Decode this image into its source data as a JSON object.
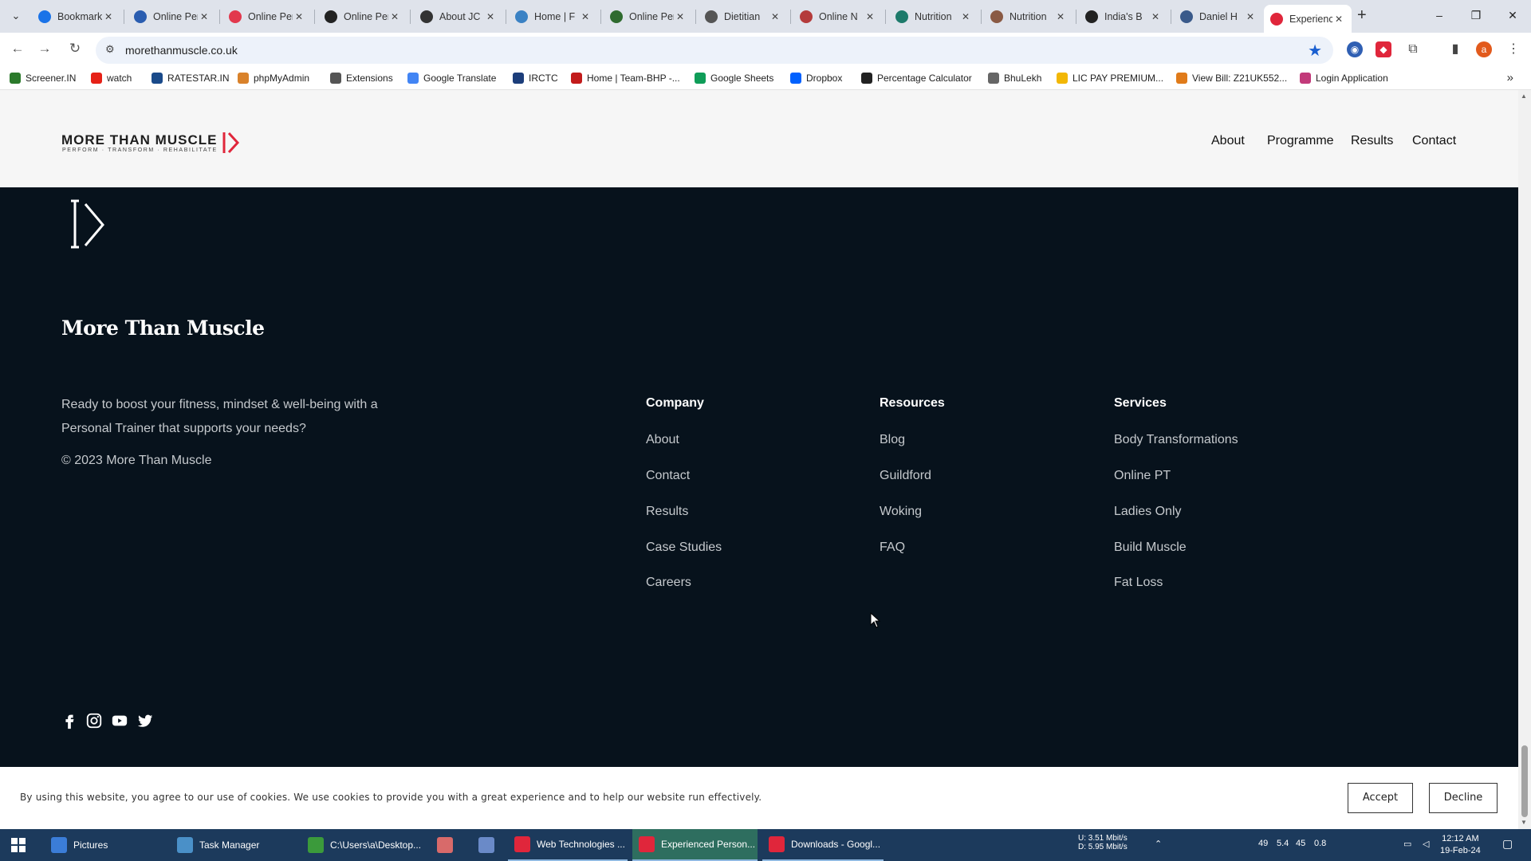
{
  "browser": {
    "tabs": [
      {
        "title": "Bookmarks",
        "color": "#1a73e8"
      },
      {
        "title": "Online Personal",
        "color": "#2a5db0"
      },
      {
        "title": "Online Personal",
        "color": "#e2384d"
      },
      {
        "title": "Online Personal",
        "color": "#222222"
      },
      {
        "title": "About JC",
        "color": "#333333"
      },
      {
        "title": "Home | F",
        "color": "#3b82c4"
      },
      {
        "title": "Online Personal",
        "color": "#2f6b2f"
      },
      {
        "title": "Dietitian",
        "color": "#555555"
      },
      {
        "title": "Online N",
        "color": "#b43b3b"
      },
      {
        "title": "Nutrition",
        "color": "#1d7a6b"
      },
      {
        "title": "Nutrition",
        "color": "#8a5a44"
      },
      {
        "title": "India's B",
        "color": "#222222"
      },
      {
        "title": "Daniel H",
        "color": "#3a5a8a"
      },
      {
        "title": "Experienced",
        "color": "#e0263b"
      }
    ],
    "new_tab": "+",
    "window_controls": {
      "minimize": "–",
      "restore": "❐",
      "close": "✕"
    },
    "url": "morethanmuscle.co.uk",
    "profile_initial": "a",
    "bookmarks": [
      {
        "label": "Screener.IN",
        "color": "#2b7a2b"
      },
      {
        "label": "watch",
        "color": "#e62117"
      },
      {
        "label": "RATESTAR.IN",
        "color": "#1a4a8a"
      },
      {
        "label": "phpMyAdmin",
        "color": "#d9822b"
      },
      {
        "label": "Extensions",
        "color": "#555555"
      },
      {
        "label": "Google Translate",
        "color": "#4285f4"
      },
      {
        "label": "IRCTC",
        "color": "#1c3d7a"
      },
      {
        "label": "Home | Team-BHP -...",
        "color": "#c21b1b"
      },
      {
        "label": "Google Sheets",
        "color": "#0f9d58"
      },
      {
        "label": "Dropbox",
        "color": "#0061fe"
      },
      {
        "label": "Percentage Calculator",
        "color": "#222222"
      },
      {
        "label": "BhuLekh",
        "color": "#666666"
      },
      {
        "label": "LIC PAY PREMIUM...",
        "color": "#f2b705"
      },
      {
        "label": "View Bill: Z21UK552...",
        "color": "#e07b1a"
      },
      {
        "label": "Login Application",
        "color": "#c23a7a"
      }
    ]
  },
  "site": {
    "logo_text": "MORE THAN MUSCLE",
    "logo_sub": "PERFORM · TRANSFORM · REHABILITATE",
    "nav": [
      "About",
      "Programme",
      "Results",
      "Contact"
    ],
    "brand_name": "More Than Muscle",
    "tagline": "Ready to boost your fitness, mindset & well-being with a Personal Trainer that supports your needs?",
    "copyright": "© 2023 More Than Muscle",
    "columns": [
      {
        "heading": "Company",
        "links": [
          "About",
          "Contact",
          "Results",
          "Case Studies",
          "Careers"
        ]
      },
      {
        "heading": "Resources",
        "links": [
          "Blog",
          "Guildford",
          "Woking",
          "FAQ"
        ]
      },
      {
        "heading": "Services",
        "links": [
          "Body Transformations",
          "Online PT",
          "Ladies Only",
          "Build Muscle",
          "Fat Loss"
        ]
      }
    ],
    "social": [
      "facebook-icon",
      "instagram-icon",
      "youtube-icon",
      "twitter-icon"
    ],
    "cookie": {
      "text": "By using this website, you agree to our use of cookies. We use cookies to provide you with a great experience and to help our website run effectively.",
      "accept": "Accept",
      "decline": "Decline"
    },
    "accent": "#e0263b"
  },
  "taskbar": {
    "items": [
      {
        "label": "Pictures",
        "color": "#3b7dd8"
      },
      {
        "label": "Task Manager",
        "color": "#4a90c8"
      },
      {
        "label": "C:\\Users\\a\\Desktop...",
        "color": "#3b9a3b"
      },
      {
        "label": "",
        "color": "#d86a6a"
      },
      {
        "label": "",
        "color": "#6a8ac8"
      },
      {
        "label": "Web Technologies ...",
        "color": "#e0263b"
      },
      {
        "label": "Experienced Person...",
        "color": "#e0263b"
      },
      {
        "label": "Downloads - Googl...",
        "color": "#e0263b"
      }
    ],
    "net_up": "U:   3.51 Mbit/s",
    "net_down": "D:   5.95 Mbit/s",
    "tray_nums": [
      "49",
      "5.4",
      "45",
      "0.8"
    ],
    "time": "12:12 AM",
    "date": "19-Feb-24"
  }
}
